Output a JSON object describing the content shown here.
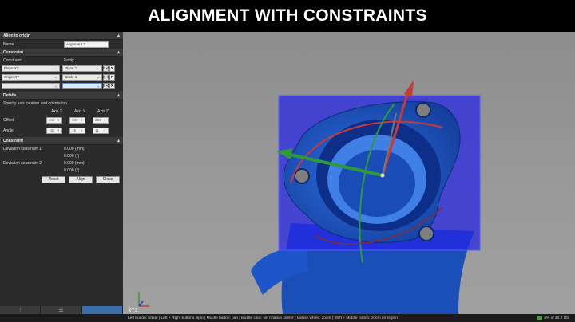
{
  "banner": {
    "title": "ALIGNMENT WITH CONSTRAINTS"
  },
  "panel": {
    "title": "Align to origin",
    "name_label": "Name",
    "name_value": "Alignment 3",
    "constraint_section": "Constraint",
    "col_constraint": "Constraint",
    "col_entity": "Entity",
    "constraints": [
      {
        "constraint": "Plane XY",
        "entity": "Plane 1"
      },
      {
        "constraint": "Origin XY",
        "entity": "Circle 1"
      },
      {
        "constraint": "",
        "entity": ""
      }
    ],
    "details_section": "Details",
    "details_hint": "Specify axis location and orientation",
    "axis_x": "Axis X",
    "axis_y": "Axis Y",
    "axis_z": "Axis Z",
    "offset_label": "Offset",
    "offset": [
      "242",
      "389",
      "283"
    ],
    "angle_label": "Angle",
    "angle": [
      "-40",
      "18",
      "11"
    ],
    "status_section": "Constraint",
    "dev1_label": "Deviation constraint 1:",
    "dev1_mm": "0.000 (mm)",
    "dev1_deg": "0.000 (°)",
    "dev2_label": "Deviation constraint 2:",
    "dev2_mm": "0.000 (mm)",
    "dev2_deg": "0.000 (°)",
    "reset": "Reset",
    "align": "Align",
    "close": "Close"
  },
  "viewport": {
    "triad_x": "X",
    "triad_y": "Y",
    "triad_z": "Z"
  },
  "status": {
    "message": "Left button: rotate  |  Left + Right buttons: spin  |  Middle button: pan  |  Middle click: set rotation center  |  Mouse wheel: zoom  |  Shift + Middle button: zoom on region",
    "memory": "5% of 30.2 Gb"
  },
  "colors": {
    "panel_bg": "#2b2b2b",
    "plane_blue": "#2a2ae6",
    "part_blue": "#1f5fd6",
    "axis_red": "#c83a3a",
    "axis_green": "#2e9a3a"
  }
}
